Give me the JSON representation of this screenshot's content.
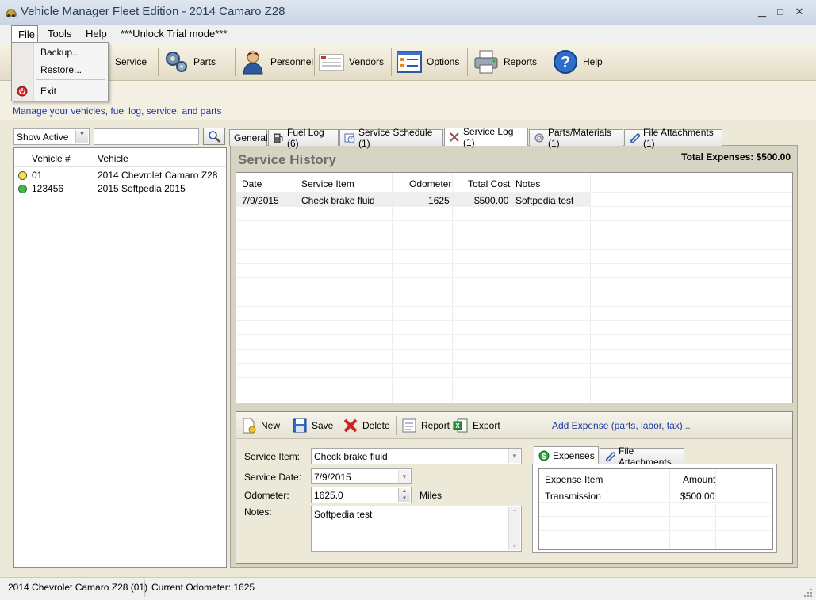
{
  "window": {
    "title": "Vehicle Manager Fleet Edition - 2014 Camaro Z28",
    "min": "▁",
    "max": "□",
    "close": "✕"
  },
  "menu": {
    "file": "File",
    "tools": "Tools",
    "help": "Help",
    "trial": "***Unlock Trial mode***",
    "file_items": [
      "Backup...",
      "Restore...",
      "Exit"
    ]
  },
  "toolbar": {
    "service": "Service",
    "parts": "Parts",
    "personnel": "Personnel",
    "vendors": "Vendors",
    "options": "Options",
    "reports": "Reports",
    "help": "Help"
  },
  "subtitle": "Manage your vehicles, fuel log, service, and parts",
  "filter": {
    "value": "Show Active",
    "search_value": ""
  },
  "vehicles": {
    "headers": [
      "Vehicle #",
      "Vehicle"
    ],
    "rows": [
      {
        "num": "01",
        "name": "2014 Chevrolet Camaro Z28",
        "status_color": "#f5e43a"
      },
      {
        "num": "123456",
        "name": "2015 Softpedia 2015",
        "status_color": "#3fbf3f"
      }
    ]
  },
  "tabs": [
    "General",
    "Fuel Log (6)",
    "Service Schedule (1)",
    "Service Log (1)",
    "Parts/Materials (1)",
    "File Attachments (1)"
  ],
  "active_tab": "Service Log (1)",
  "history": {
    "title": "Service History",
    "total_expenses": "Total Expenses: $500.00",
    "headers": [
      "Date",
      "Service Item",
      "Odometer",
      "Total Cost",
      "Notes"
    ],
    "rows": [
      {
        "date": "7/9/2015",
        "item": "Check brake fluid",
        "odometer": "1625",
        "cost": "$500.00",
        "notes": "Softpedia test"
      }
    ]
  },
  "detail_toolbar": {
    "new": "New",
    "save": "Save",
    "delete": "Delete",
    "report": "Report",
    "export": "Export",
    "add_expense": "Add Expense (parts, labor, tax)..."
  },
  "form": {
    "service_item_label": "Service Item:",
    "service_item": "Check brake fluid",
    "service_date_label": "Service Date:",
    "service_date": "7/9/2015",
    "odometer_label": "Odometer:",
    "odometer": "1625.0",
    "odometer_unit": "Miles",
    "notes_label": "Notes:",
    "notes": "Softpedia test"
  },
  "expenses": {
    "tabs": [
      "Expenses",
      "File Attachments"
    ],
    "headers": [
      "Expense Item",
      "Amount"
    ],
    "rows": [
      {
        "item": "Transmission",
        "amount": "$500.00"
      }
    ]
  },
  "status": {
    "vehicle": "2014 Chevrolet Camaro Z28 (01)",
    "odometer": "Current Odometer: 1625"
  },
  "colors": {
    "accent_link": "#1a3aa8",
    "title_text": "#2d3e57"
  }
}
